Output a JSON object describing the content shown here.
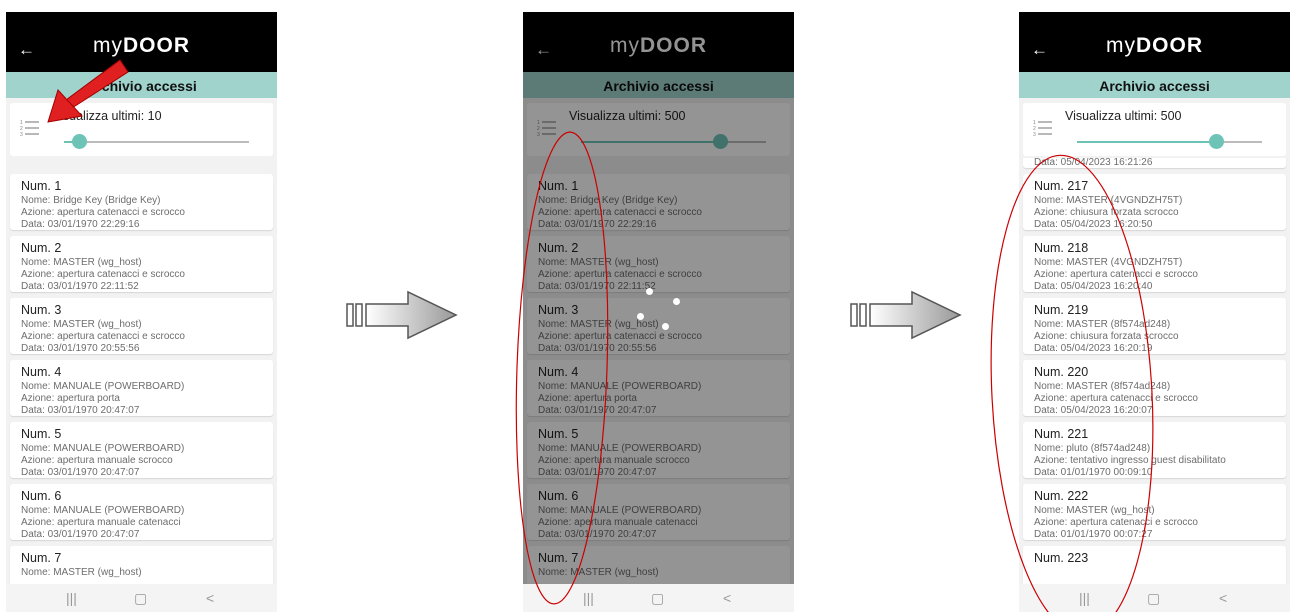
{
  "app": {
    "back_icon": "←",
    "logo_my": "my",
    "logo_door": "DOOR",
    "title": "Archivio accessi"
  },
  "nav": {
    "recents": "|||",
    "home": "▢",
    "back": "<"
  },
  "phones": [
    {
      "slider_label": "Visualizza ultimi: 10",
      "slider_level": 0.08,
      "entries": [
        {
          "num": "Num. 1",
          "nome": "Nome: Bridge Key (Bridge Key)",
          "azione": "Azione: apertura catenacci e scrocco",
          "data": "Data: 03/01/1970 22:29:16"
        },
        {
          "num": "Num. 2",
          "nome": "Nome: MASTER (wg_host)",
          "azione": "Azione: apertura catenacci e scrocco",
          "data": "Data: 03/01/1970 22:11:52"
        },
        {
          "num": "Num. 3",
          "nome": "Nome: MASTER (wg_host)",
          "azione": "Azione: apertura catenacci e scrocco",
          "data": "Data: 03/01/1970 20:55:56"
        },
        {
          "num": "Num. 4",
          "nome": "Nome: MANUALE (POWERBOARD)",
          "azione": "Azione: apertura porta",
          "data": "Data: 03/01/1970 20:47:07"
        },
        {
          "num": "Num. 5",
          "nome": "Nome: MANUALE (POWERBOARD)",
          "azione": "Azione: apertura manuale scrocco",
          "data": "Data: 03/01/1970 20:47:07"
        },
        {
          "num": "Num. 6",
          "nome": "Nome: MANUALE (POWERBOARD)",
          "azione": "Azione: apertura manuale catenacci",
          "data": "Data: 03/01/1970 20:47:07"
        },
        {
          "num": "Num. 7",
          "nome": "Nome: MASTER (wg_host)",
          "azione": "",
          "data": ""
        }
      ]
    },
    {
      "slider_label": "Visualizza ultimi: 500",
      "slider_level": 0.75,
      "entries": [
        {
          "num": "Num. 1",
          "nome": "Nome: Bridge Key (Bridge Key)",
          "azione": "Azione: apertura catenacci e scrocco",
          "data": "Data: 03/01/1970 22:29:16"
        },
        {
          "num": "Num. 2",
          "nome": "Nome: MASTER (wg_host)",
          "azione": "Azione: apertura catenacci e scrocco",
          "data": "Data: 03/01/1970 22:11:52"
        },
        {
          "num": "Num. 3",
          "nome": "Nome: MASTER (wg_host)",
          "azione": "Azione: apertura catenacci e scrocco",
          "data": "Data: 03/01/1970 20:55:56"
        },
        {
          "num": "Num. 4",
          "nome": "Nome: MANUALE (POWERBOARD)",
          "azione": "Azione: apertura porta",
          "data": "Data: 03/01/1970 20:47:07"
        },
        {
          "num": "Num. 5",
          "nome": "Nome: MANUALE (POWERBOARD)",
          "azione": "Azione: apertura manuale scrocco",
          "data": "Data: 03/01/1970 20:47:07"
        },
        {
          "num": "Num. 6",
          "nome": "Nome: MANUALE (POWERBOARD)",
          "azione": "Azione: apertura manuale catenacci",
          "data": "Data: 03/01/1970 20:47:07"
        },
        {
          "num": "Num. 7",
          "nome": "Nome: MASTER (wg_host)",
          "azione": "",
          "data": ""
        }
      ]
    },
    {
      "slider_label": "Visualizza ultimi: 500",
      "slider_level": 0.75,
      "partial_top": "Data: 05/04/2023 16:21:26",
      "entries": [
        {
          "num": "Num. 217",
          "nome": "Nome: MASTER (4VGNDZH75T)",
          "azione": "Azione: chiusura forzata scrocco",
          "data": "Data: 05/04/2023 16:20:50"
        },
        {
          "num": "Num. 218",
          "nome": "Nome: MASTER (4VGNDZH75T)",
          "azione": "Azione: apertura catenacci e scrocco",
          "data": "Data: 05/04/2023 16:20:40"
        },
        {
          "num": "Num. 219",
          "nome": "Nome: MASTER (8f574ad248)",
          "azione": "Azione: chiusura forzata scrocco",
          "data": "Data: 05/04/2023 16:20:19"
        },
        {
          "num": "Num. 220",
          "nome": "Nome: MASTER (8f574ad248)",
          "azione": "Azione: apertura catenacci e scrocco",
          "data": "Data: 05/04/2023 16:20:07"
        },
        {
          "num": "Num. 221",
          "nome": "Nome: pluto (8f574ad248)",
          "azione": "Azione: tentativo ingresso guest disabilitato",
          "data": "Data: 01/01/1970 00:09:10"
        },
        {
          "num": "Num. 222",
          "nome": "Nome: MASTER (wg_host)",
          "azione": "Azione: apertura catenacci e scrocco",
          "data": "Data: 01/01/1970 00:07:27"
        },
        {
          "num": "Num. 223",
          "nome": "",
          "azione": "",
          "data": ""
        }
      ]
    }
  ],
  "colors": {
    "header": "#000000",
    "title_bar": "#9fd3cc",
    "accent": "#6ec3b7",
    "annotation_red": "#e02020",
    "ellipse_red": "#cc0000"
  },
  "annotations": {
    "pointer_arrow_icon": "red-arrow-icon",
    "transition_arrow_icon": "gray-right-arrow-icon",
    "loading_icon": "spinner-icon"
  }
}
